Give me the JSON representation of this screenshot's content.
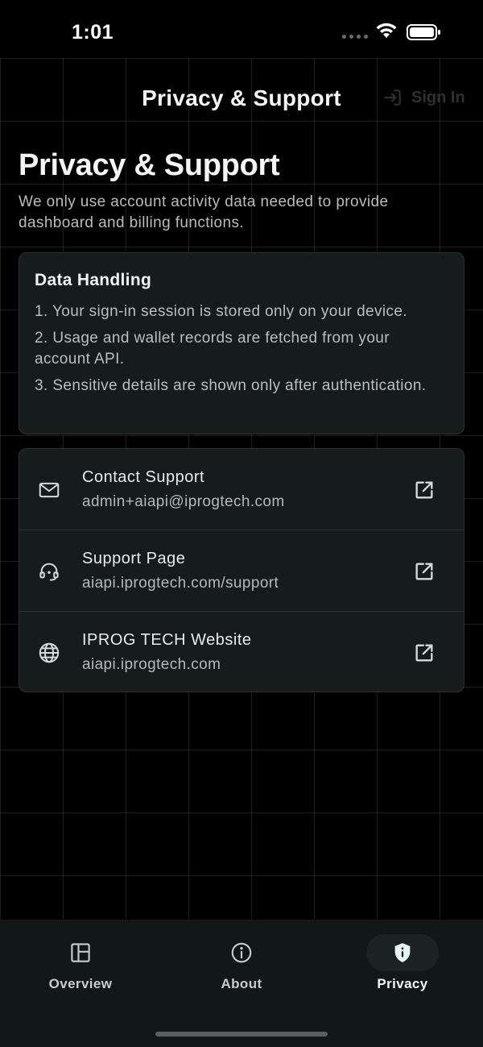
{
  "status_bar": {
    "time": "1:01"
  },
  "nav": {
    "title": "Privacy & Support",
    "sign_in_label": "Sign In"
  },
  "main": {
    "title": "Privacy & Support",
    "description": "We only use account activity data needed to provide dashboard and billing functions.",
    "data_handling": {
      "heading": "Data Handling",
      "items": [
        "1. Your sign-in session is stored only on your device.",
        "2. Usage and wallet records are fetched from your account API.",
        "3. Sensitive details are shown only after authentication."
      ]
    },
    "links": [
      {
        "icon": "mail-icon",
        "title": "Contact Support",
        "subtitle": "admin+aiapi@iprogtech.com"
      },
      {
        "icon": "headset-icon",
        "title": "Support Page",
        "subtitle": "aiapi.iprogtech.com/support"
      },
      {
        "icon": "globe-icon",
        "title": "IPROG TECH Website",
        "subtitle": "aiapi.iprogtech.com"
      }
    ]
  },
  "tab_bar": {
    "tabs": [
      {
        "label": "Overview",
        "icon": "dashboard-icon"
      },
      {
        "label": "About",
        "icon": "info-icon"
      },
      {
        "label": "Privacy",
        "icon": "shield-icon",
        "active": true
      }
    ]
  },
  "colors": {
    "background": "#000000",
    "card": "#161b1b",
    "tab_bar": "#121717",
    "text": "#f4f5f5",
    "muted_text": "#b7bdbc"
  }
}
